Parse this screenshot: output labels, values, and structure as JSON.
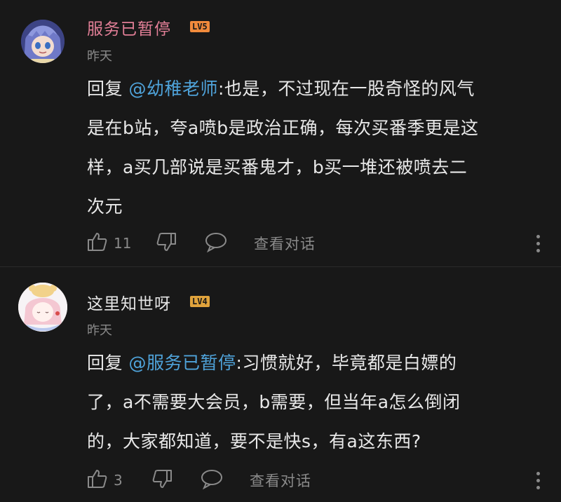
{
  "comments": [
    {
      "username": "服务已暂停",
      "level": "LV5",
      "level_color": "#f08a3c",
      "time": "昨天",
      "reply_prefix": "回复 ",
      "mention": "@幼稚老师",
      "lines": [
        ":也是，不过现在一股奇怪的风气",
        "是在b站，夸a喷b是政治正确，每次买番季更是这",
        "样，a买几部说是买番鬼才，b买一堆还被喷去二",
        "次元"
      ],
      "likes": "11",
      "view_dialog": "查看对话"
    },
    {
      "username": "这里知世呀",
      "level": "LV4",
      "level_color": "#e0a33c",
      "time": "昨天",
      "reply_prefix": "回复 ",
      "mention": "@服务已暂停",
      "lines": [
        ":习惯就好，毕竟都是白嫖的",
        "了，a不需要大会员，b需要，但当年a怎么倒闭",
        "的，大家都知道，要不是快s，有a这东西?"
      ],
      "likes": "3",
      "view_dialog": "查看对话"
    }
  ],
  "colors": {
    "background": "#181818",
    "username_vip": "#e27f97",
    "mention": "#4fa3da",
    "muted": "#8a8a8a"
  },
  "icons": [
    "thumb-up-icon",
    "thumb-down-icon",
    "comment-bubble-icon",
    "more-vertical-icon"
  ]
}
